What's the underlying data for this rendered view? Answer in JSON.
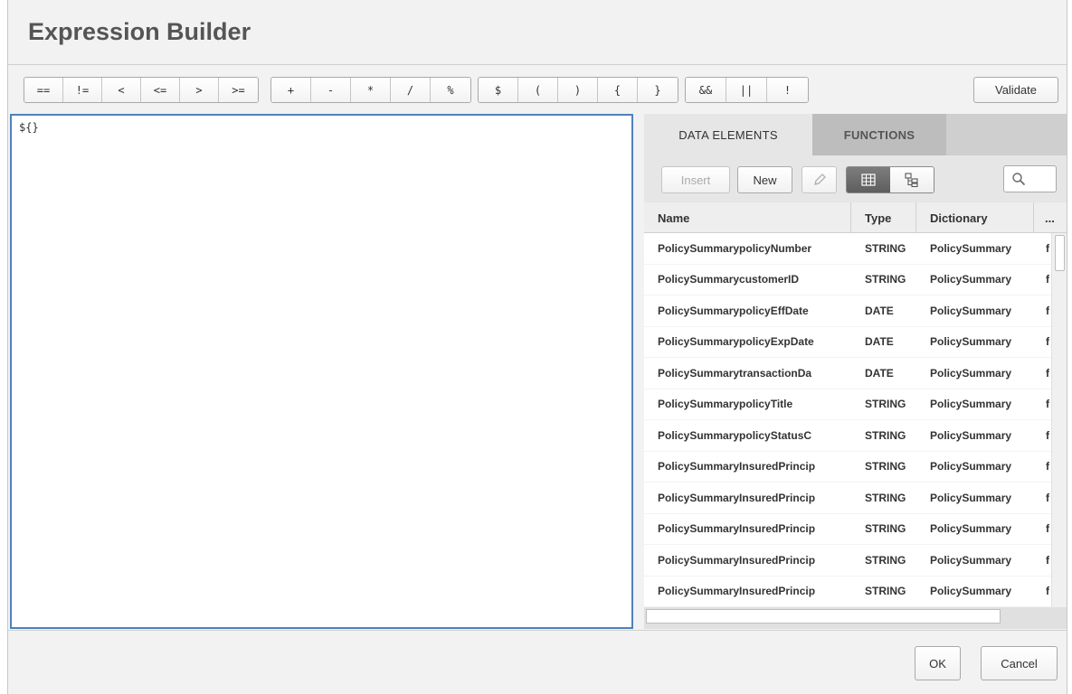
{
  "dialog": {
    "title": "Expression Builder"
  },
  "toolbar": {
    "groups": [
      [
        "==",
        "!=",
        "<",
        "<=",
        ">",
        ">="
      ],
      [
        "+",
        "-",
        "*",
        "/",
        "%"
      ],
      [
        "$",
        "(",
        ")",
        "{",
        "}"
      ],
      [
        "&&",
        "||",
        "!"
      ]
    ],
    "validate_label": "Validate"
  },
  "editor": {
    "value": "${}"
  },
  "tabs": [
    {
      "label": "DATA ELEMENTS",
      "active": true
    },
    {
      "label": "FUNCTIONS",
      "active": false
    }
  ],
  "panel_toolbar": {
    "insert_label": "Insert",
    "new_label": "New",
    "icons": {
      "edit": "pencil-icon",
      "grid_view": "grid-view-icon",
      "tree_view": "tree-view-icon",
      "search": "search-icon"
    }
  },
  "grid": {
    "columns": [
      "Name",
      "Type",
      "Dictionary",
      "..."
    ],
    "rows": [
      [
        "PolicySummarypolicyNumber",
        "STRING",
        "PolicySummary",
        "f"
      ],
      [
        "PolicySummarycustomerID",
        "STRING",
        "PolicySummary",
        "f"
      ],
      [
        "PolicySummarypolicyEffDate",
        "DATE",
        "PolicySummary",
        "f"
      ],
      [
        "PolicySummarypolicyExpDate",
        "DATE",
        "PolicySummary",
        "f"
      ],
      [
        "PolicySummarytransactionDa",
        "DATE",
        "PolicySummary",
        "f"
      ],
      [
        "PolicySummarypolicyTitle",
        "STRING",
        "PolicySummary",
        "f"
      ],
      [
        "PolicySummarypolicyStatusC",
        "STRING",
        "PolicySummary",
        "f"
      ],
      [
        "PolicySummaryInsuredPrincip",
        "STRING",
        "PolicySummary",
        "f"
      ],
      [
        "PolicySummaryInsuredPrincip",
        "STRING",
        "PolicySummary",
        "f"
      ],
      [
        "PolicySummaryInsuredPrincip",
        "STRING",
        "PolicySummary",
        "f"
      ],
      [
        "PolicySummaryInsuredPrincip",
        "STRING",
        "PolicySummary",
        "f"
      ],
      [
        "PolicySummaryInsuredPrincip",
        "STRING",
        "PolicySummary",
        "f"
      ]
    ]
  },
  "footer": {
    "ok_label": "OK",
    "cancel_label": "Cancel"
  },
  "colors": {
    "editor_border": "#4f81bd",
    "active_view": "#6b6b6b"
  }
}
